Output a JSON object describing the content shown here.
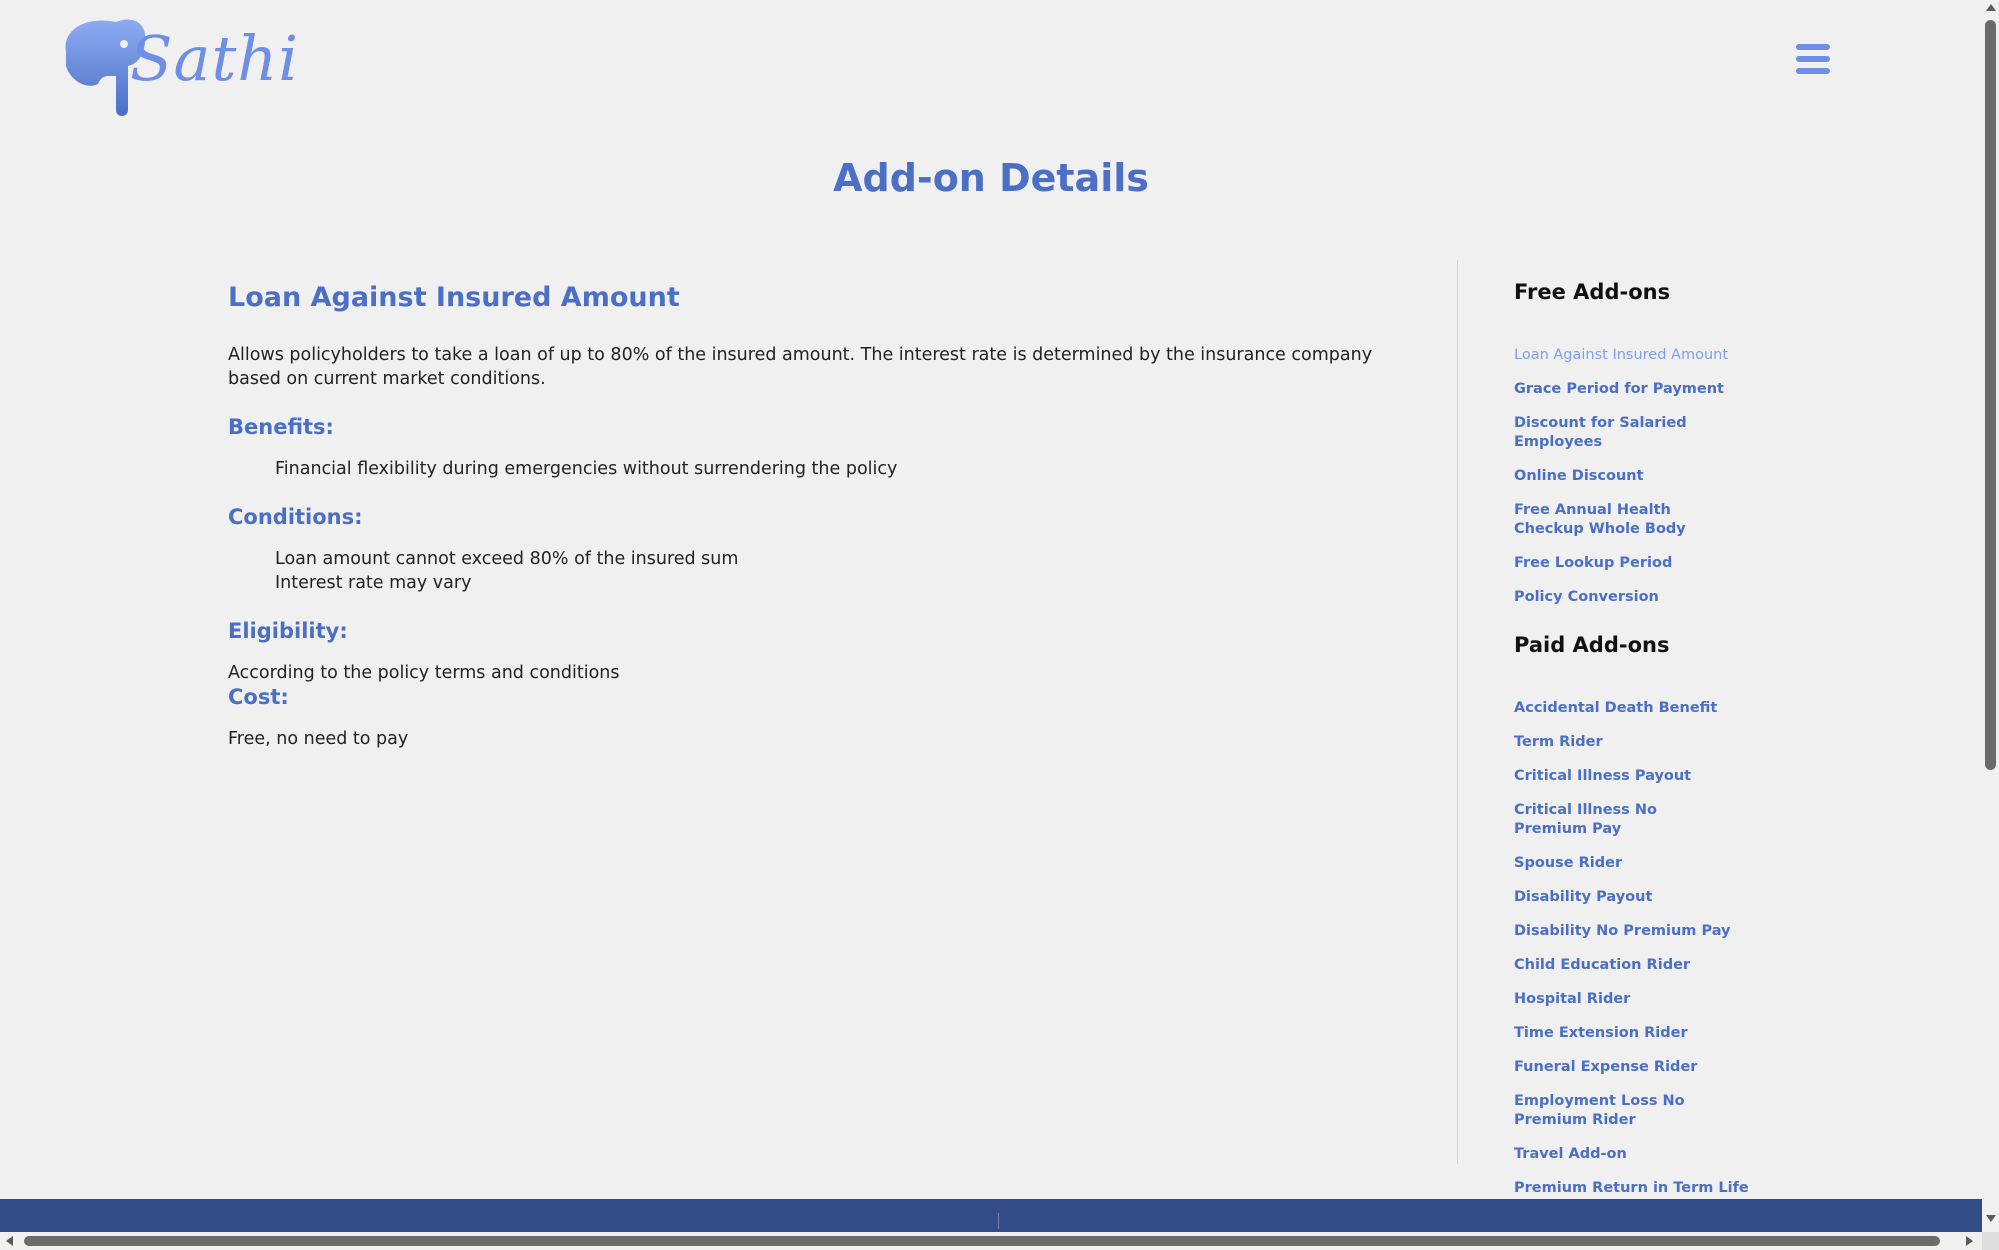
{
  "brand": {
    "logo_text": "Sathi",
    "color": "#6f8fe6"
  },
  "header": {
    "menu_icon": "hamburger-menu-icon"
  },
  "page_title": "Add-on Details",
  "main": {
    "title": "Loan Against Insured Amount",
    "description": "Allows policyholders to take a loan of up to 80% of the insured amount. The interest rate is determined by the insurance company based on current market conditions.",
    "benefits_heading": "Benefits:",
    "benefits": [
      "Financial flexibility during emergencies without surrendering the policy"
    ],
    "conditions_heading": "Conditions:",
    "conditions": [
      "Loan amount cannot exceed 80% of the insured sum",
      "Interest rate may vary"
    ],
    "eligibility_heading": "Eligibility:",
    "eligibility": "According to the policy terms and conditions",
    "cost_heading": "Cost:",
    "cost": "Free, no need to pay"
  },
  "sidebar": {
    "free_heading": "Free Add-ons",
    "free_items": [
      "Loan Against Insured Amount",
      "Grace Period for Payment",
      "Discount for Salaried Employees",
      "Online Discount",
      "Free Annual Health Checkup Whole Body",
      "Free Lookup Period",
      "Policy Conversion"
    ],
    "paid_heading": "Paid Add-ons",
    "paid_items": [
      "Accidental Death Benefit",
      "Term Rider",
      "Critical Illness Payout",
      "Critical Illness No Premium Pay",
      "Spouse Rider",
      "Disability Payout",
      "Disability No Premium Pay",
      "Child Education Rider",
      "Hospital Rider",
      "Time Extension Rider",
      "Funeral Expense Rider",
      "Employment Loss No Premium Rider",
      "Travel Add-on",
      "Premium Return in Term Life"
    ]
  },
  "colors": {
    "accent": "#4a6fc4",
    "active_link": "#7fa0e8",
    "footer": "#334d8a",
    "background": "#f0f0f0"
  }
}
